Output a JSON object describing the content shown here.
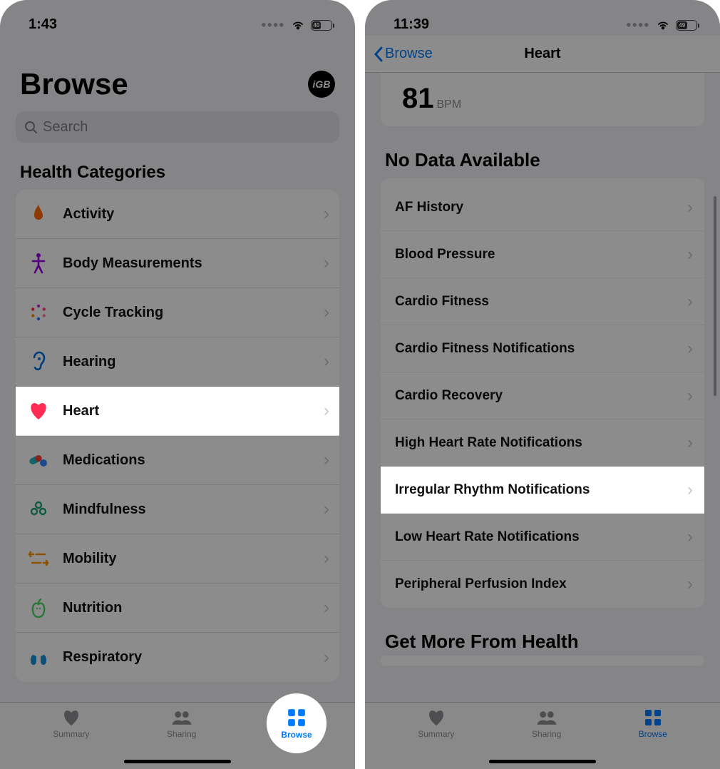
{
  "left": {
    "time": "1:43",
    "battery": "40",
    "title": "Browse",
    "avatar": "iGB",
    "search_placeholder": "Search",
    "section_header": "Health Categories",
    "categories": [
      {
        "label": "Activity",
        "icon": "flame",
        "color": "#ff6b00"
      },
      {
        "label": "Body Measurements",
        "icon": "body",
        "color": "#9b00e6"
      },
      {
        "label": "Cycle Tracking",
        "icon": "cycle",
        "color": "#ff2d55"
      },
      {
        "label": "Hearing",
        "icon": "ear",
        "color": "#0070e0"
      },
      {
        "label": "Heart",
        "icon": "heart",
        "color": "#ff2d55"
      },
      {
        "label": "Medications",
        "icon": "pill",
        "color": "#1fb6c4"
      },
      {
        "label": "Mindfulness",
        "icon": "mindfulness",
        "color": "#18a576"
      },
      {
        "label": "Mobility",
        "icon": "mobility",
        "color": "#ff9500"
      },
      {
        "label": "Nutrition",
        "icon": "nutrition",
        "color": "#4cd964"
      },
      {
        "label": "Respiratory",
        "icon": "lungs",
        "color": "#1a93d9"
      }
    ],
    "tabs": {
      "summary": "Summary",
      "sharing": "Sharing",
      "browse": "Browse"
    }
  },
  "right": {
    "time": "11:39",
    "battery": "49",
    "back": "Browse",
    "title": "Heart",
    "stat_value": "81",
    "stat_unit": "BPM",
    "no_data_header": "No Data Available",
    "items": [
      "AF History",
      "Blood Pressure",
      "Cardio Fitness",
      "Cardio Fitness Notifications",
      "Cardio Recovery",
      "High Heart Rate Notifications",
      "Irregular Rhythm Notifications",
      "Low Heart Rate Notifications",
      "Peripheral Perfusion Index"
    ],
    "get_more": "Get More From Health",
    "tabs": {
      "summary": "Summary",
      "sharing": "Sharing",
      "browse": "Browse"
    }
  }
}
